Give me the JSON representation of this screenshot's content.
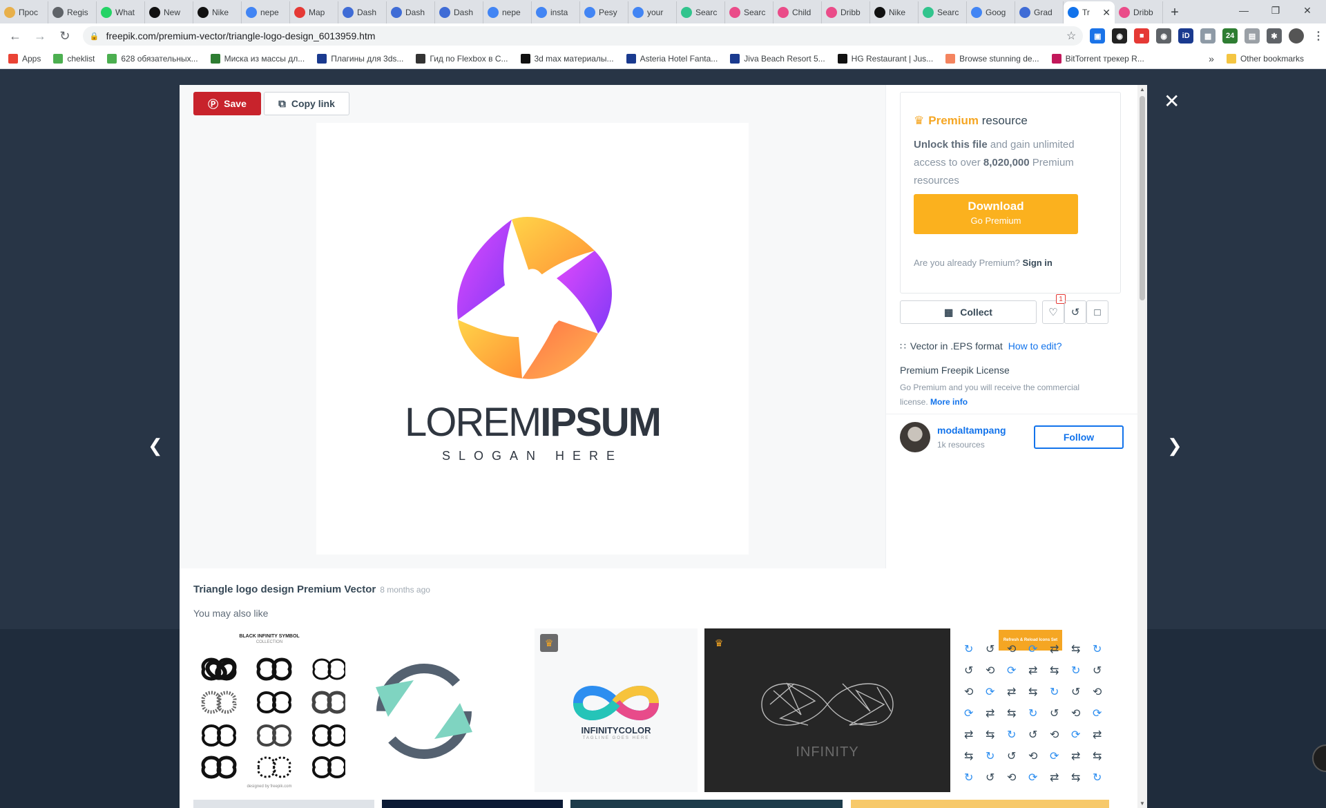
{
  "browser": {
    "tabs": [
      {
        "label": "Прос",
        "color": "#e8b04b"
      },
      {
        "label": "Regis",
        "color": "#5f6368"
      },
      {
        "label": "What",
        "color": "#25d366"
      },
      {
        "label": "New",
        "color": "#111111"
      },
      {
        "label": "Nike",
        "color": "#111111"
      },
      {
        "label": "nepe",
        "color": "#4285f4"
      },
      {
        "label": "Map",
        "color": "#e53935"
      },
      {
        "label": "Dash",
        "color": "#3f6cd6"
      },
      {
        "label": "Dash",
        "color": "#3f6cd6"
      },
      {
        "label": "Dash",
        "color": "#3f6cd6"
      },
      {
        "label": "nepe",
        "color": "#4285f4"
      },
      {
        "label": "insta",
        "color": "#4285f4"
      },
      {
        "label": "Pesy",
        "color": "#4285f4"
      },
      {
        "label": "your",
        "color": "#4285f4"
      },
      {
        "label": "Searc",
        "color": "#31c48d"
      },
      {
        "label": "Searc",
        "color": "#ea4c89"
      },
      {
        "label": "Child",
        "color": "#ea4c89"
      },
      {
        "label": "Dribb",
        "color": "#ea4c89"
      },
      {
        "label": "Nike",
        "color": "#111111"
      },
      {
        "label": "Searc",
        "color": "#31c48d"
      },
      {
        "label": "Goog",
        "color": "#4285f4"
      },
      {
        "label": "Grad",
        "color": "#3f6cd6"
      },
      {
        "label": "Tr",
        "color": "#1273eb",
        "active": true
      },
      {
        "label": "Dribb",
        "color": "#ea4c89"
      }
    ],
    "url": "freepik.com/premium-vector/triangle-logo-design_6013959.htm",
    "bookmarks": [
      {
        "label": "Apps",
        "color": "#ea4335"
      },
      {
        "label": "cheklist",
        "color": "#4caf50"
      },
      {
        "label": "628 обязательных...",
        "color": "#4caf50"
      },
      {
        "label": "Миска из массы дл...",
        "color": "#2e7d32"
      },
      {
        "label": "Плагины для 3ds...",
        "color": "#1a3a8f"
      },
      {
        "label": "Гид по Flexbox в С...",
        "color": "#333333"
      },
      {
        "label": "3d max материалы...",
        "color": "#111111"
      },
      {
        "label": "Asteria Hotel Fanta...",
        "color": "#1a3a8f"
      },
      {
        "label": "Jiva Beach Resort 5...",
        "color": "#1a3a8f"
      },
      {
        "label": "HG Restaurant | Jus...",
        "color": "#111111"
      },
      {
        "label": "Browse stunning de...",
        "color": "#f4845f"
      },
      {
        "label": "BitTorrent трекер R...",
        "color": "#c2185b"
      }
    ],
    "other_bookmarks": "Other bookmarks"
  },
  "modal": {
    "save_label": "Save",
    "copy_label": "Copy link",
    "logo": {
      "light": "LOREM",
      "bold": "IPSUM",
      "slogan": "SLOGAN HERE"
    },
    "premium": {
      "title_accent": "Premium",
      "title_rest": "resource",
      "unlock_bold": "Unlock this file",
      "unlock_rest1": "and gain unlimited access to over",
      "count": "8,020,000",
      "unlock_rest2": "Premium resources",
      "download": "Download",
      "go_premium": "Go Premium",
      "already": "Are you already Premium?",
      "sign_in": "Sign in"
    },
    "collect_label": "Collect",
    "like_count": "1",
    "format_text": "Vector in .EPS format",
    "how_to_edit": "How to edit?",
    "license_title": "Premium Freepik License",
    "license_desc": "Go Premium and you will receive the commercial license.",
    "more_info": "More info",
    "author": {
      "name": "modaltampang",
      "resources": "1k resources"
    },
    "follow_label": "Follow",
    "resource_title": "Triangle logo design Premium Vector",
    "age": "8 months ago",
    "also_like": "You may also like",
    "thumbs": {
      "infinity_title": "BLACK INFINITY SYMBOL",
      "infinity_sub": "COLLECTION",
      "infinity_credit": "designed by freepik.com",
      "color_title": "INFINITYCOLOR",
      "color_tag": "TAGLINE GOES HERE",
      "dark_title": "INFINITY",
      "icons_title": "Refresh & Reload Icons Set"
    }
  },
  "colors": {
    "accent": "#1273eb",
    "premium": "#f5a623",
    "download": "#fbb11e",
    "pinterest": "#c8232c"
  }
}
